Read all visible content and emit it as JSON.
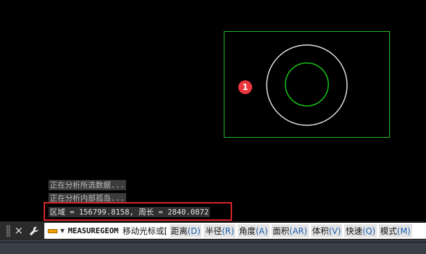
{
  "canvas": {
    "background": "#000000",
    "rect_color": "#22c322",
    "outer_circle_color": "#e6e6e6",
    "inner_circle_color": "#19c819",
    "marker_label": "1",
    "marker_color": "#e8363c"
  },
  "history": {
    "line1": "正在分析所选数据...",
    "line2": "正在分析内部孤岛...",
    "result": "区域 = 156799.8158, 周长 = 2840.0872"
  },
  "command_bar": {
    "close_icon": "×",
    "wrench_icon": "wrench",
    "command_name": "MEASUREGEOM",
    "prompt": "移动光标或[",
    "options": [
      {
        "label": "距离",
        "key": "(D)"
      },
      {
        "label": "半径",
        "key": "(R)"
      },
      {
        "label": "角度",
        "key": "(A)"
      },
      {
        "label": "面积",
        "key": "(AR)"
      },
      {
        "label": "体积",
        "key": "(V)"
      },
      {
        "label": "快速",
        "key": "(Q)"
      },
      {
        "label": "模式",
        "key": "(M)"
      }
    ]
  },
  "highlight_color": "#e0262b"
}
